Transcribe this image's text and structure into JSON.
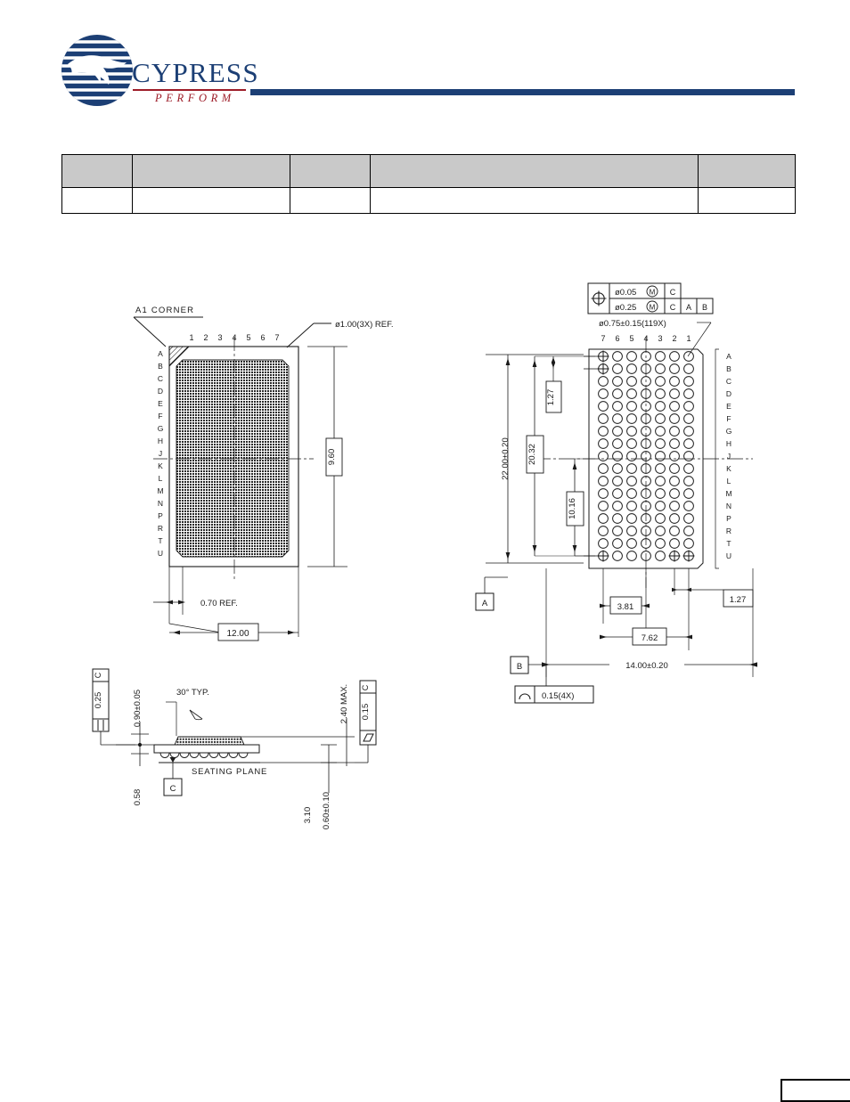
{
  "brand": {
    "name": "CYPRESS",
    "tagline": "PERFORM",
    "logo_icon": "cypress-globe-logo",
    "rule_color": "#1c3f75",
    "accent_color": "#9d1c28"
  },
  "spec_table": {
    "columns": [
      "",
      "",
      "",
      "",
      ""
    ],
    "header_bg": "#c9c9c9",
    "rows": [
      {
        "cells": [
          "",
          "",
          "",
          "",
          ""
        ]
      }
    ]
  },
  "package_drawing": {
    "title": "",
    "top_view": {
      "name": "top-view-package-outline",
      "a1_corner_label": "A1 CORNER",
      "column_labels": [
        "1",
        "2",
        "3",
        "4",
        "5",
        "6",
        "7"
      ],
      "row_labels": [
        "A",
        "B",
        "C",
        "D",
        "E",
        "F",
        "G",
        "H",
        "J",
        "K",
        "L",
        "M",
        "N",
        "P",
        "R",
        "T",
        "U"
      ],
      "dimensions": {
        "corner_radius": "ø1.00(3X) REF.",
        "body_height": "9.60",
        "edge_offset": "0.70 REF.",
        "body_width": "12.00"
      }
    },
    "bottom_view": {
      "name": "bottom-view-ball-array",
      "column_labels": [
        "7",
        "6",
        "5",
        "4",
        "3",
        "2",
        "1"
      ],
      "row_labels": [
        "A",
        "B",
        "C",
        "D",
        "E",
        "F",
        "G",
        "H",
        "J",
        "K",
        "L",
        "M",
        "N",
        "P",
        "R",
        "T",
        "U"
      ],
      "ball_count_columns": 7,
      "ball_count_rows": 17,
      "feature_control": {
        "symbol": "position-symbol",
        "row1_tolerance": "ø0.05",
        "row1_modifier": "M",
        "row1_datums": [
          "C"
        ],
        "row2_tolerance": "ø0.25",
        "row2_modifier": "M",
        "row2_datums": [
          "C",
          "A",
          "B"
        ]
      },
      "ball_diameter": "ø0.75±0.15(119X)",
      "dimensions": {
        "overall_height": "22.00±0.20",
        "array_height": "20.32",
        "pitch_top": "1.27",
        "half_array_height": "10.16",
        "half_array_width": "3.81",
        "array_width": "7.62",
        "pitch_right": "1.27",
        "overall_width": "14.00±0.20"
      },
      "datums": {
        "a": "A",
        "b": "B"
      },
      "profile_tolerance": {
        "symbol": "profile-of-surface",
        "value": "0.15(4X)"
      }
    },
    "side_view": {
      "name": "side-view-cross-section",
      "parallelism": {
        "symbol": "parallelism",
        "value": "0.25",
        "datum": "C"
      },
      "flatness": {
        "symbol": "flatness",
        "value": "0.15",
        "datum": "C"
      },
      "seating_plane_label": "SEATING PLANE",
      "datum_c": "C",
      "dimensions": {
        "ball_height": "0.90±0.05",
        "standoff": "0.58",
        "chamfer_angle": "30° TYP.",
        "max_height": "2.40 MAX.",
        "substrate_thickness": "0.60±0.10",
        "body_thickness": "3.10"
      }
    }
  },
  "footer": {
    "page_box": ""
  }
}
